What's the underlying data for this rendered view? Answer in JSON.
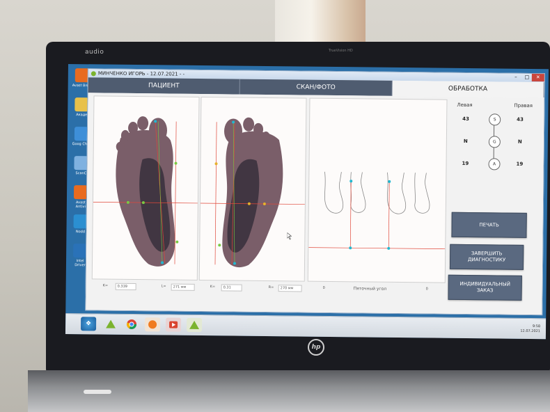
{
  "device": {
    "brand": "audio",
    "webcam": "TrueVision HD",
    "logo": "hp"
  },
  "window": {
    "title": "МИНЧЕНКО ИГОРЬ - 12.07.2021 - -",
    "controls": [
      "–",
      "□",
      "✕"
    ]
  },
  "tabs": [
    {
      "label": "ПАЦИЕНТ",
      "active": false
    },
    {
      "label": "СКАН/ФОТО",
      "active": false
    },
    {
      "label": "ОБРАБОТКА",
      "active": true
    }
  ],
  "measurements": {
    "k_left_label": "K=",
    "k_left_value": "0.339",
    "l_label": "L=",
    "l_value": "271 мм",
    "k_right_label": "K=",
    "k_right_value": "0.31",
    "r_label": "R=",
    "r_value": "270 мм",
    "heel_zero": "0",
    "heel_angle_label": "Пяточный угол",
    "heel_angle_value": "0"
  },
  "sizes": {
    "left_header": "Левая",
    "right_header": "Правая",
    "rows": [
      {
        "left": "43",
        "code": "S",
        "right": "43"
      },
      {
        "left": "N",
        "code": "G",
        "right": "N"
      },
      {
        "left": "19",
        "code": "A",
        "right": "19"
      }
    ]
  },
  "actions": {
    "print": "ПЕЧАТЬ",
    "finish_line1": "ЗАВЕРШИТЬ",
    "finish_line2": "ДИАГНОСТИКУ",
    "order_line1": "ИНДИВИДУАЛЬНЫЙ",
    "order_line2": "ЗАКАЗ"
  },
  "desktop_icons": [
    {
      "label": "Avast Brow",
      "color": "#e86b1f"
    },
    {
      "label": "Акаде",
      "color": "#e8c14a"
    },
    {
      "label": "Goog Chro",
      "color": "#3e8fd8"
    },
    {
      "label": "ScanC",
      "color": "#7fb1e0"
    },
    {
      "label": "Avast Antivi",
      "color": "#e86b1f"
    },
    {
      "label": "Nodd",
      "color": "#2b8fd1"
    },
    {
      "label": "Intel Driver",
      "color": "#2a72b8"
    }
  ],
  "taskbar": {
    "items": [
      "windows-start",
      "app-a",
      "chrome",
      "avast",
      "video",
      "app-a-2"
    ],
    "tray_time": "9:58",
    "tray_date": "12.07.2021"
  },
  "colors": {
    "tab_inactive": "#4f5c70",
    "button": "#5a6980",
    "guide_line": "#e0483a",
    "marker_cyan": "#22b8d0",
    "marker_green": "#7ac943"
  }
}
